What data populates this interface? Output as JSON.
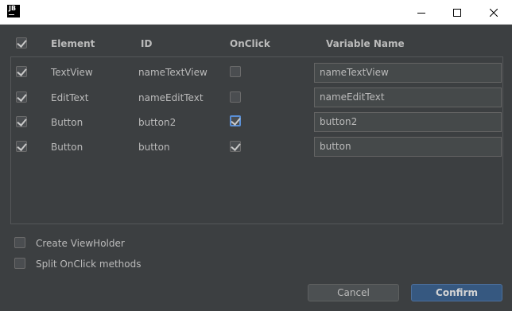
{
  "window": {
    "app_logo": "JB",
    "controls": [
      "minimize-icon",
      "maximize-icon",
      "close-icon"
    ]
  },
  "header": {
    "select_all_checked": true,
    "element": "Element",
    "id": "ID",
    "onclick": "OnClick",
    "variable_name": "Variable Name"
  },
  "rows": [
    {
      "checked": true,
      "element": "TextView",
      "id": "nameTextView",
      "onclick": false,
      "variable": "nameTextView"
    },
    {
      "checked": true,
      "element": "EditText",
      "id": "nameEditText",
      "onclick": false,
      "variable": "nameEditText"
    },
    {
      "checked": true,
      "element": "Button",
      "id": "button2",
      "onclick": true,
      "variable": "button2"
    },
    {
      "checked": true,
      "element": "Button",
      "id": "button",
      "onclick": true,
      "variable": "button"
    }
  ],
  "options": {
    "create_viewholder": {
      "label": "Create ViewHolder",
      "checked": false
    },
    "split_onclick": {
      "label": "Split OnClick methods",
      "checked": false
    }
  },
  "buttons": {
    "cancel": "Cancel",
    "confirm": "Confirm"
  },
  "colors": {
    "background": "#3c3f41",
    "confirm_button": "#365880",
    "text": "#bbbbbb"
  }
}
